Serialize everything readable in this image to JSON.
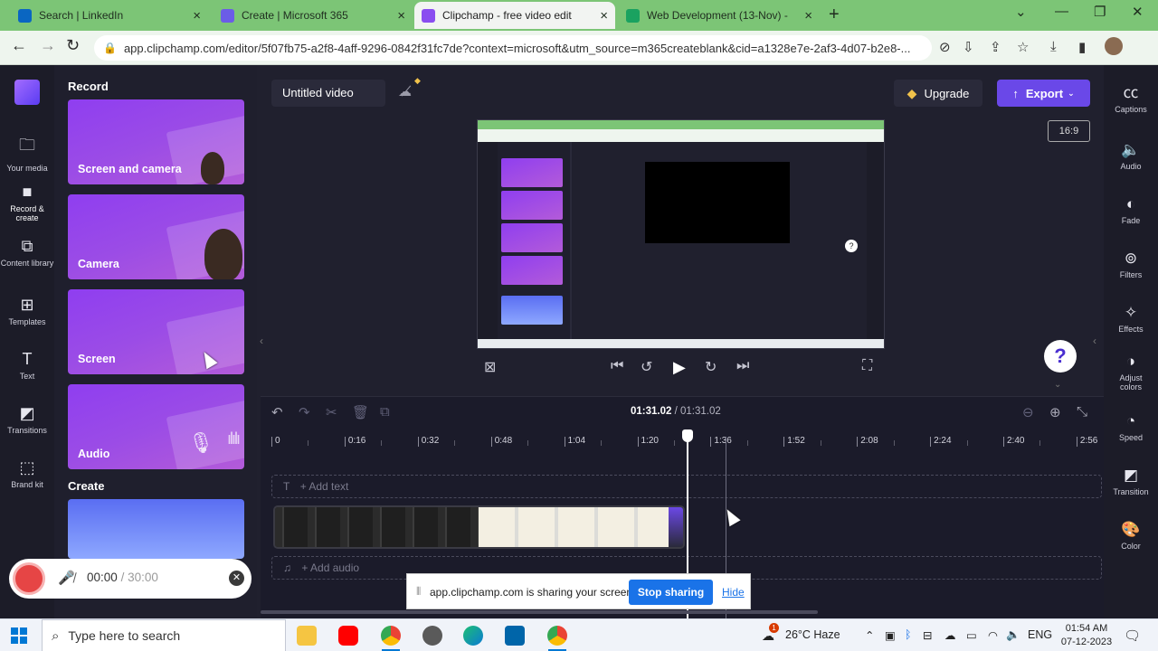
{
  "browser": {
    "tabs": [
      {
        "label": "Search | LinkedIn",
        "color": "#0a66c2",
        "active": false
      },
      {
        "label": "Create | Microsoft 365",
        "color": "#6b5ce7",
        "active": false
      },
      {
        "label": "Clipchamp - free video edit",
        "color": "#8a4df0",
        "active": true
      },
      {
        "label": "Web Development (13-Nov) - ",
        "color": "#1aa260",
        "active": false
      }
    ],
    "new_tab": "+",
    "url": "app.clipchamp.com/editor/5f07fb75-a2f8-4aff-9296-0842f31fc7de?context=microsoft&utm_source=m365createblank&cid=a1328e7e-2af3-4d07-b2e8-..."
  },
  "leftnav": {
    "items": [
      {
        "label": "Your media",
        "icon": "folder-icon"
      },
      {
        "label": "Record & create",
        "icon": "camera-icon"
      },
      {
        "label": "Content library",
        "icon": "library-icon"
      },
      {
        "label": "Templates",
        "icon": "templates-icon"
      },
      {
        "label": "Text",
        "icon": "text-icon"
      },
      {
        "label": "Transitions",
        "icon": "transitions-icon"
      },
      {
        "label": "Brand kit",
        "icon": "brand-kit-icon"
      }
    ]
  },
  "panel": {
    "record_heading": "Record",
    "cards": [
      "Screen and camera",
      "Camera",
      "Screen",
      "Audio"
    ],
    "create_heading": "Create"
  },
  "recorder": {
    "elapsed": "00:00",
    "separator": "/",
    "limit": "30:00"
  },
  "toolbar": {
    "title": "Untitled video",
    "upgrade_label": "Upgrade",
    "export_label": "Export",
    "aspect_ratio": "16:9"
  },
  "rightnav": {
    "items": [
      {
        "label": "Captions",
        "icon": "captions-icon"
      },
      {
        "label": "Audio",
        "icon": "speaker-icon"
      },
      {
        "label": "Fade",
        "icon": "fade-icon"
      },
      {
        "label": "Filters",
        "icon": "filters-icon"
      },
      {
        "label": "Effects",
        "icon": "effects-icon"
      },
      {
        "label": "Adjust colors",
        "icon": "adjust-colors-icon"
      },
      {
        "label": "Speed",
        "icon": "speed-icon"
      },
      {
        "label": "Transition",
        "icon": "transition-icon"
      },
      {
        "label": "Color",
        "icon": "color-icon"
      }
    ]
  },
  "timeline": {
    "current": "01:31.02",
    "separator": " / ",
    "total": "01:31.02",
    "ruler": [
      "0",
      "0:16",
      "0:32",
      "0:48",
      "1:04",
      "1:20",
      "1:36",
      "1:52",
      "2:08",
      "2:24",
      "2:40",
      "2:56"
    ],
    "add_text": "+ Add text",
    "add_audio": "+ Add audio"
  },
  "share_banner": {
    "message": "app.clipchamp.com is sharing your screen.",
    "stop_label": "Stop sharing",
    "hide_label": "Hide"
  },
  "taskbar": {
    "search_placeholder": "Type here to search",
    "weather": "26°C  Haze",
    "weather_badge": "1",
    "language": "ENG",
    "time": "01:54 AM",
    "date": "07-12-2023"
  },
  "colors": {
    "accent": "#6a48e8",
    "record_red": "#e64545",
    "share_blue": "#1a73e8",
    "browser_green": "#7cc576"
  }
}
